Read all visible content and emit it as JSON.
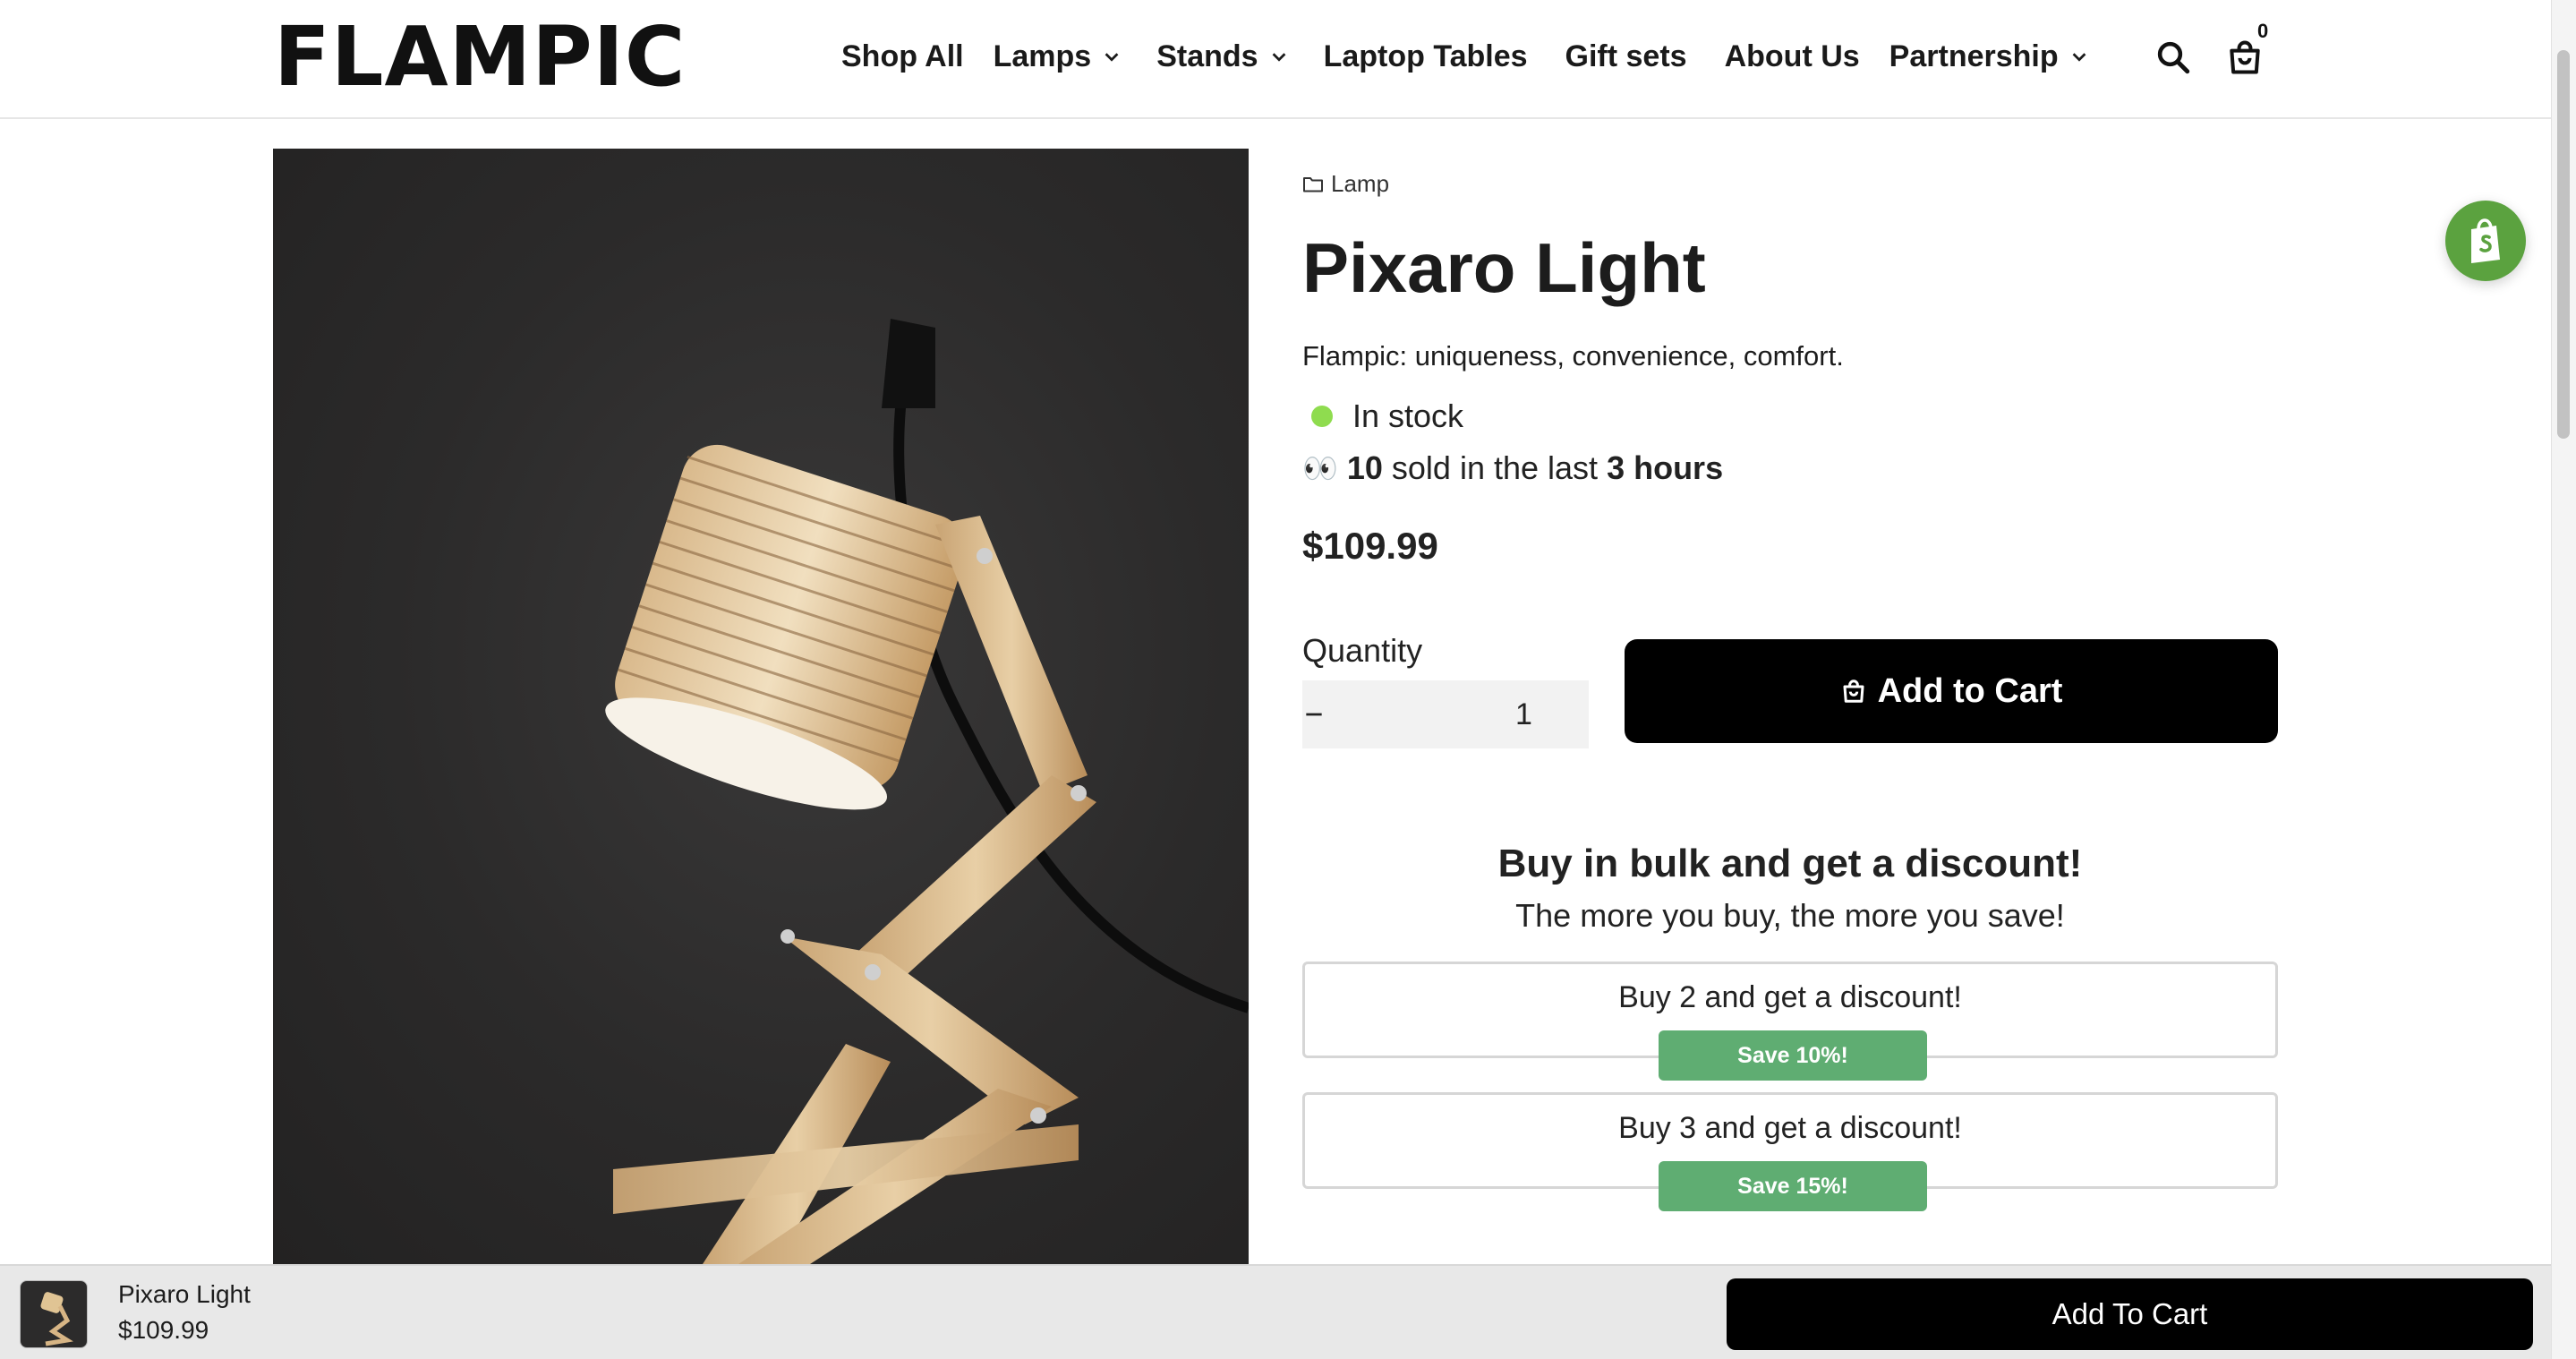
{
  "header": {
    "logo": "FLAMPIC",
    "nav": [
      {
        "label": "Shop All",
        "has_dropdown": false
      },
      {
        "label": "Lamps",
        "has_dropdown": true
      },
      {
        "label": "Stands",
        "has_dropdown": true
      },
      {
        "label": "Laptop Tables",
        "has_dropdown": false
      },
      {
        "label": "Gift sets",
        "has_dropdown": false
      },
      {
        "label": "About Us",
        "has_dropdown": false
      },
      {
        "label": "Partnership",
        "has_dropdown": true
      }
    ],
    "icons": {
      "search": "search-icon",
      "cart": "shopping-bag-icon"
    },
    "cart_count": "0"
  },
  "product": {
    "breadcrumb": "Lamp",
    "title": "Pixaro Light",
    "tagline": "Flampic: uniqueness, convenience, comfort.",
    "stock_status": "In stock",
    "stock_color": "#8fdc4f",
    "sold": {
      "emoji": "👀",
      "count": "10",
      "middle": "sold in the last",
      "period": "3 hours"
    },
    "price": "$109.99",
    "quantity_label": "Quantity",
    "quantity_value": "1",
    "add_to_cart_label": "Add to Cart"
  },
  "bulk": {
    "title": "Buy in bulk and get a discount!",
    "subtitle": "The more you buy, the more you save!",
    "offers": [
      {
        "label": "Buy 2 and get a discount!",
        "badge": "Save 10%!"
      },
      {
        "label": "Buy 3 and get a discount!",
        "badge": "Save 15%!"
      }
    ],
    "badge_color": "#5fad72"
  },
  "sticky_bar": {
    "name": "Pixaro Light",
    "price": "$109.99",
    "button_label": "Add To Cart"
  },
  "shopify_badge_color": "#5ba23f"
}
